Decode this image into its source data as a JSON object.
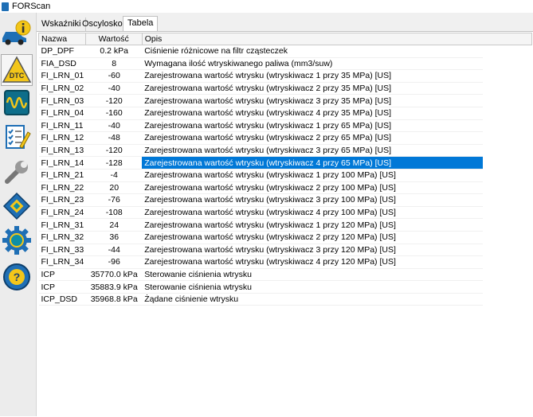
{
  "app": {
    "title": "FORScan"
  },
  "sidebar": {
    "items": [
      {
        "name": "vehicle-info",
        "icon": "car-info-icon"
      },
      {
        "name": "dtc",
        "icon": "dtc-warning-icon",
        "label": "DTC"
      },
      {
        "name": "oscilloscope",
        "icon": "oscilloscope-icon"
      },
      {
        "name": "tests",
        "icon": "checklist-icon"
      },
      {
        "name": "service",
        "icon": "wrench-icon"
      },
      {
        "name": "configuration",
        "icon": "chip-icon"
      },
      {
        "name": "settings",
        "icon": "gear-icon"
      },
      {
        "name": "help",
        "icon": "help-icon",
        "label": "?"
      }
    ]
  },
  "tabs": [
    {
      "label": "Wskaźniki",
      "selected": false
    },
    {
      "label": "Oscyloskop",
      "selected": false
    },
    {
      "label": "Tabela",
      "selected": true
    }
  ],
  "table": {
    "columns": [
      "Nazwa",
      "Wartość",
      "Opis"
    ],
    "rows": [
      {
        "name": "DP_DPF",
        "value": "0.2 kPa",
        "desc": "Ciśnienie różnicowe na filtr cząsteczek"
      },
      {
        "name": "FIA_DSD",
        "value": "8",
        "desc": "Wymagana ilość wtryskiwanego paliwa (mm3/suw)"
      },
      {
        "name": "FI_LRN_01",
        "value": "-60",
        "desc": "Zarejestrowana wartość wtrysku (wtryskiwacz 1 przy 35 MPa) [US]"
      },
      {
        "name": "FI_LRN_02",
        "value": "-40",
        "desc": "Zarejestrowana wartość wtrysku (wtryskiwacz 2 przy 35 MPa) [US]"
      },
      {
        "name": "FI_LRN_03",
        "value": "-120",
        "desc": "Zarejestrowana wartość wtrysku (wtryskiwacz 3 przy 35 MPa) [US]"
      },
      {
        "name": "FI_LRN_04",
        "value": "-160",
        "desc": "Zarejestrowana wartość wtrysku (wtryskiwacz 4 przy 35 MPa) [US]"
      },
      {
        "name": "FI_LRN_11",
        "value": "-40",
        "desc": "Zarejestrowana wartość wtrysku (wtryskiwacz 1 przy 65 MPa) [US]"
      },
      {
        "name": "FI_LRN_12",
        "value": "-48",
        "desc": "Zarejestrowana wartość wtrysku (wtryskiwacz 2 przy 65 MPa) [US]"
      },
      {
        "name": "FI_LRN_13",
        "value": "-120",
        "desc": "Zarejestrowana wartość wtrysku (wtryskiwacz 3 przy 65 MPa) [US]"
      },
      {
        "name": "FI_LRN_14",
        "value": "-128",
        "desc": "Zarejestrowana wartość wtrysku (wtryskiwacz 4 przy 65 MPa) [US]",
        "selected": true
      },
      {
        "name": "FI_LRN_21",
        "value": "-4",
        "desc": "Zarejestrowana wartość wtrysku (wtryskiwacz 1 przy 100 MPa) [US]"
      },
      {
        "name": "FI_LRN_22",
        "value": "20",
        "desc": "Zarejestrowana wartość wtrysku (wtryskiwacz 2 przy 100 MPa) [US]"
      },
      {
        "name": "FI_LRN_23",
        "value": "-76",
        "desc": "Zarejestrowana wartość wtrysku (wtryskiwacz 3 przy 100 MPa) [US]"
      },
      {
        "name": "FI_LRN_24",
        "value": "-108",
        "desc": "Zarejestrowana wartość wtrysku (wtryskiwacz 4 przy 100 MPa) [US]"
      },
      {
        "name": "FI_LRN_31",
        "value": "24",
        "desc": "Zarejestrowana wartość wtrysku (wtryskiwacz 1 przy 120 MPa) [US]"
      },
      {
        "name": "FI_LRN_32",
        "value": "36",
        "desc": "Zarejestrowana wartość wtrysku (wtryskiwacz 2 przy 120 MPa) [US]"
      },
      {
        "name": "FI_LRN_33",
        "value": "-44",
        "desc": "Zarejestrowana wartość wtrysku (wtryskiwacz 3 przy 120 MPa) [US]"
      },
      {
        "name": "FI_LRN_34",
        "value": "-96",
        "desc": "Zarejestrowana wartość wtrysku (wtryskiwacz 4 przy 120 MPa) [US]"
      },
      {
        "name": "ICP",
        "value": "35770.0 kPa",
        "desc": "Sterowanie ciśnienia wtrysku"
      },
      {
        "name": "ICP",
        "value": "35883.9 kPa",
        "desc": "Sterowanie ciśnienia wtrysku"
      },
      {
        "name": "ICP_DSD",
        "value": "35968.8 kPa",
        "desc": "Żądane ciśnienie wtrysku"
      }
    ]
  },
  "colors": {
    "selection": "#0078d7",
    "accent_blue": "#1f6fb5",
    "yellow": "#f3c61a",
    "teal": "#0e8fa6"
  }
}
